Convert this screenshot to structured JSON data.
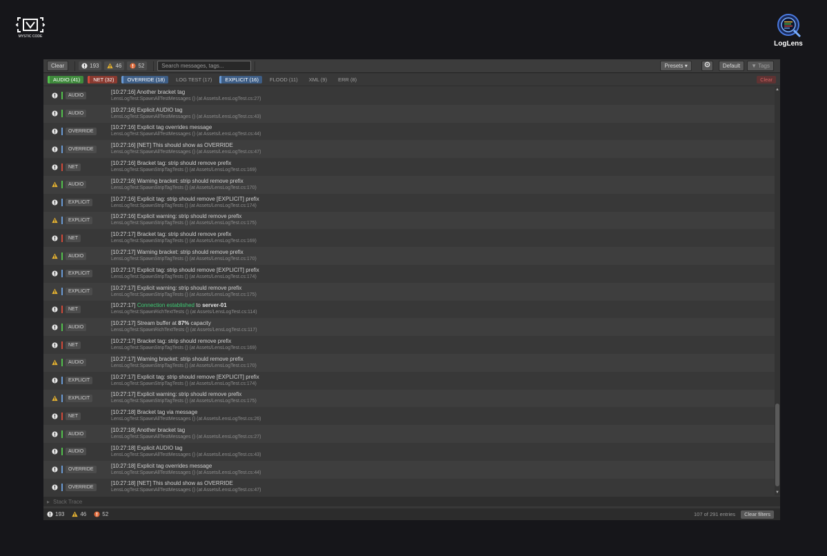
{
  "branding": {
    "left_logo_text": "MYSTIC CODE",
    "right_logo_text": "LogLens"
  },
  "toolbar": {
    "clear_label": "Clear",
    "error_count": "193",
    "warning_count": "46",
    "exception_count": "52",
    "search_placeholder": "Search messages, tags...",
    "presets_label": "Presets ▾",
    "default_label": "Default",
    "tags_label": "Tags"
  },
  "filters": {
    "chips": [
      {
        "label": "AUDIO (41)",
        "state": "on",
        "kind": "audio"
      },
      {
        "label": "NET (32)",
        "state": "on",
        "kind": "net"
      },
      {
        "label": "OVERRIDE (18)",
        "state": "on",
        "kind": "override"
      },
      {
        "label": "LOG TEST (17)",
        "state": "off",
        "kind": "plain"
      },
      {
        "label": "EXPLICIT (16)",
        "state": "on",
        "kind": "explicit"
      },
      {
        "label": "FLOOD (11)",
        "state": "off",
        "kind": "plain"
      },
      {
        "label": "XML (9)",
        "state": "off",
        "kind": "plain"
      },
      {
        "label": "ERR (8)",
        "state": "off",
        "kind": "plain"
      }
    ],
    "clear_label": "Clear"
  },
  "colors": {
    "audio": "#52c04c",
    "net": "#d04a3a",
    "override": "#6a9ad4",
    "explicit": "#6a9ad4",
    "warning": "#e8b431",
    "info": "#e8e8e8",
    "exception": "#e06a3a"
  },
  "log": {
    "rows": [
      {
        "sev": "info",
        "tag": "AUDIO",
        "kind": "audio",
        "msg": "[10:27:16] Another bracket tag",
        "src": "LensLogTest:SpawnAllTestMessages () (at Assets/LensLogTest.cs:27)"
      },
      {
        "sev": "info",
        "tag": "AUDIO",
        "kind": "audio",
        "msg": "[10:27:16] Explicit AUDIO tag",
        "src": "LensLogTest:SpawnAllTestMessages () (at Assets/LensLogTest.cs:43)"
      },
      {
        "sev": "info",
        "tag": "OVERRIDE",
        "kind": "override",
        "msg": "[10:27:16] Explicit tag overrides message",
        "src": "LensLogTest:SpawnAllTestMessages () (at Assets/LensLogTest.cs:44)"
      },
      {
        "sev": "info",
        "tag": "OVERRIDE",
        "kind": "override",
        "msg": "[10:27:16] [NET] This should show as OVERRIDE",
        "src": "LensLogTest:SpawnAllTestMessages () (at Assets/LensLogTest.cs:47)"
      },
      {
        "sev": "info",
        "tag": "NET",
        "kind": "net",
        "msg": "[10:27:16] Bracket tag: strip should remove prefix",
        "src": "LensLogTest:SpawnStripTagTests () (at Assets/LensLogTest.cs:169)"
      },
      {
        "sev": "warn",
        "tag": "AUDIO",
        "kind": "audio",
        "msg": "[10:27:16] Warning bracket: strip should remove prefix",
        "src": "LensLogTest:SpawnStripTagTests () (at Assets/LensLogTest.cs:170)"
      },
      {
        "sev": "info",
        "tag": "EXPLICIT",
        "kind": "explicit",
        "msg": "[10:27:16] Explicit tag: strip should remove [EXPLICIT] prefix",
        "src": "LensLogTest:SpawnStripTagTests () (at Assets/LensLogTest.cs:174)"
      },
      {
        "sev": "warn",
        "tag": "EXPLICIT",
        "kind": "explicit",
        "msg": "[10:27:16] Explicit warning: strip should remove prefix",
        "src": "LensLogTest:SpawnStripTagTests () (at Assets/LensLogTest.cs:175)"
      },
      {
        "sev": "info",
        "tag": "NET",
        "kind": "net",
        "msg": "[10:27:17] Bracket tag: strip should remove prefix",
        "src": "LensLogTest:SpawnStripTagTests () (at Assets/LensLogTest.cs:169)"
      },
      {
        "sev": "warn",
        "tag": "AUDIO",
        "kind": "audio",
        "msg": "[10:27:17] Warning bracket: strip should remove prefix",
        "src": "LensLogTest:SpawnStripTagTests () (at Assets/LensLogTest.cs:170)"
      },
      {
        "sev": "info",
        "tag": "EXPLICIT",
        "kind": "explicit",
        "msg": "[10:27:17] Explicit tag: strip should remove [EXPLICIT] prefix",
        "src": "LensLogTest:SpawnStripTagTests () (at Assets/LensLogTest.cs:174)"
      },
      {
        "sev": "warn",
        "tag": "EXPLICIT",
        "kind": "explicit",
        "msg": "[10:27:17] Explicit warning: strip should remove prefix",
        "src": "LensLogTest:SpawnStripTagTests () (at Assets/LensLogTest.cs:175)"
      },
      {
        "sev": "info",
        "tag": "NET",
        "kind": "net",
        "msg_parts": [
          {
            "t": "[10:27:17] ",
            "c": ""
          },
          {
            "t": "Connection established",
            "c": "hl-green"
          },
          {
            "t": " to ",
            "c": ""
          },
          {
            "t": "server-01",
            "c": "bold"
          }
        ],
        "src": "LensLogTest:SpawnRichTextTests () (at Assets/LensLogTest.cs:114)"
      },
      {
        "sev": "info",
        "tag": "AUDIO",
        "kind": "audio",
        "msg_parts": [
          {
            "t": "[10:27:17] Stream buffer at ",
            "c": ""
          },
          {
            "t": "87%",
            "c": "bold"
          },
          {
            "t": " capacity",
            "c": ""
          }
        ],
        "src": "LensLogTest:SpawnRichTextTests () (at Assets/LensLogTest.cs:117)"
      },
      {
        "sev": "info",
        "tag": "NET",
        "kind": "net",
        "msg": "[10:27:17] Bracket tag: strip should remove prefix",
        "src": "LensLogTest:SpawnStripTagTests () (at Assets/LensLogTest.cs:169)"
      },
      {
        "sev": "warn",
        "tag": "AUDIO",
        "kind": "audio",
        "msg": "[10:27:17] Warning bracket: strip should remove prefix",
        "src": "LensLogTest:SpawnStripTagTests () (at Assets/LensLogTest.cs:170)"
      },
      {
        "sev": "info",
        "tag": "EXPLICIT",
        "kind": "explicit",
        "msg": "[10:27:17] Explicit tag: strip should remove [EXPLICIT] prefix",
        "src": "LensLogTest:SpawnStripTagTests () (at Assets/LensLogTest.cs:174)"
      },
      {
        "sev": "warn",
        "tag": "EXPLICIT",
        "kind": "explicit",
        "msg": "[10:27:17] Explicit warning: strip should remove prefix",
        "src": "LensLogTest:SpawnStripTagTests () (at Assets/LensLogTest.cs:175)"
      },
      {
        "sev": "info",
        "tag": "NET",
        "kind": "net",
        "msg": "[10:27:18] Bracket tag via message",
        "src": "LensLogTest:SpawnAllTestMessages () (at Assets/LensLogTest.cs:26)"
      },
      {
        "sev": "info",
        "tag": "AUDIO",
        "kind": "audio",
        "msg": "[10:27:18] Another bracket tag",
        "src": "LensLogTest:SpawnAllTestMessages () (at Assets/LensLogTest.cs:27)"
      },
      {
        "sev": "info",
        "tag": "AUDIO",
        "kind": "audio",
        "msg": "[10:27:18] Explicit AUDIO tag",
        "src": "LensLogTest:SpawnAllTestMessages () (at Assets/LensLogTest.cs:43)"
      },
      {
        "sev": "info",
        "tag": "OVERRIDE",
        "kind": "override",
        "msg": "[10:27:18] Explicit tag overrides message",
        "src": "LensLogTest:SpawnAllTestMessages () (at Assets/LensLogTest.cs:44)"
      },
      {
        "sev": "info",
        "tag": "OVERRIDE",
        "kind": "override",
        "msg": "[10:27:18] [NET] This should show as OVERRIDE",
        "src": "LensLogTest:SpawnAllTestMessages () (at Assets/LensLogTest.cs:47)"
      }
    ]
  },
  "stack_trace": {
    "label": "Stack Trace"
  },
  "status": {
    "error_count": "193",
    "warning_count": "46",
    "exception_count": "52",
    "entries_label": "107 of 291 entries",
    "clear_filters_label": "Clear filters"
  }
}
